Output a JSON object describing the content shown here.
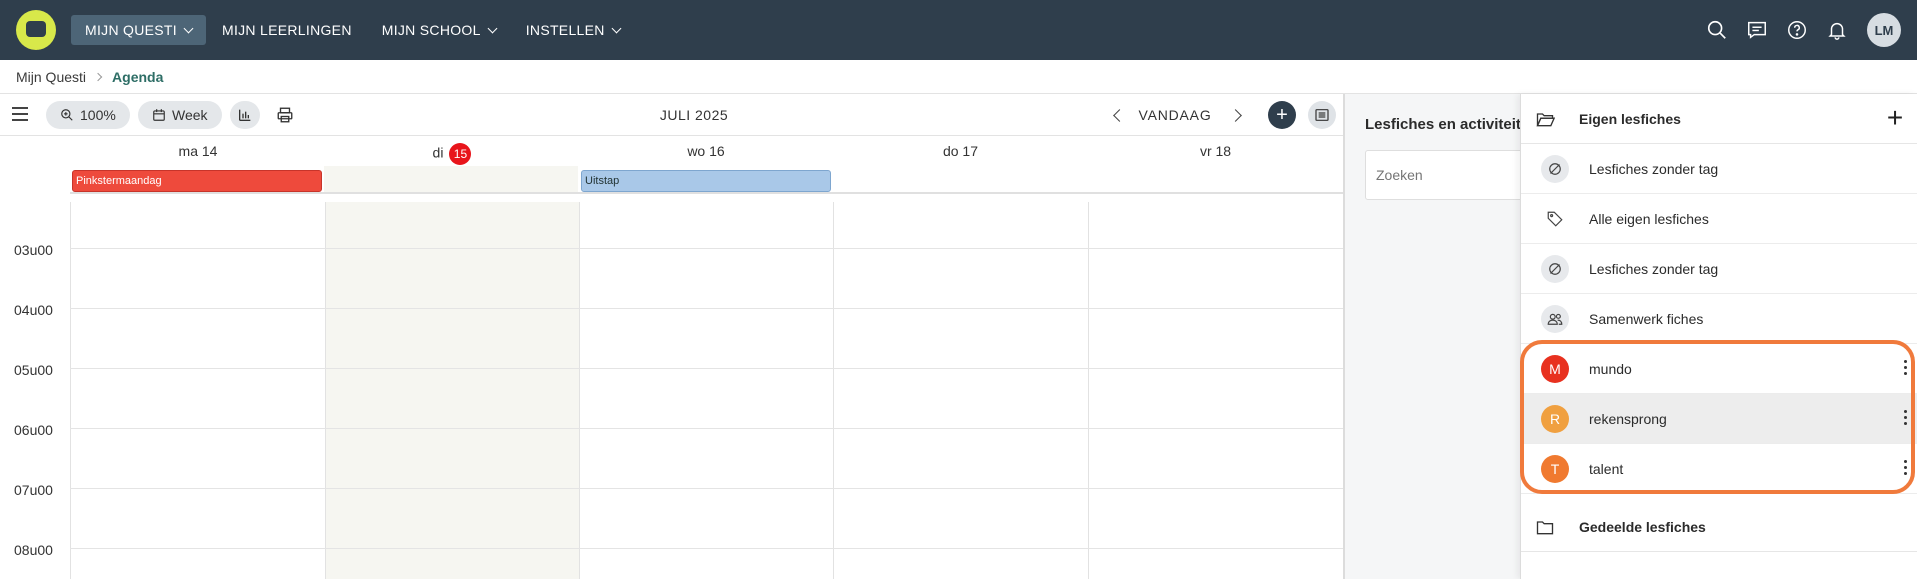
{
  "topnav": {
    "items": [
      {
        "label": "MIJN QUESTI",
        "active": true
      },
      {
        "label": "MIJN LEERLINGEN",
        "active": false
      },
      {
        "label": "MIJN SCHOOL",
        "active": false
      },
      {
        "label": "INSTELLEN",
        "active": false
      }
    ],
    "icons": [
      "search-icon",
      "chat-icon",
      "help-icon",
      "bell-icon"
    ],
    "avatar_initials": "LM"
  },
  "breadcrumb": {
    "home": "Mijn Questi",
    "current": "Agenda"
  },
  "toolbar": {
    "zoom_label": "100%",
    "view_label": "Week",
    "month_label": "JULI 2025",
    "today_label": "VANDAAG",
    "add_label": "+"
  },
  "days": [
    {
      "label": "ma 14"
    },
    {
      "label": "di",
      "badge": "15"
    },
    {
      "label": "wo 16"
    },
    {
      "label": "do 17"
    },
    {
      "label": "vr 18"
    }
  ],
  "events": [
    {
      "label": "Pinkstermaandag",
      "day": 0,
      "kind": "holiday"
    },
    {
      "label": "Uitstap",
      "day": 2,
      "kind": "trip"
    }
  ],
  "hours": [
    "03u00",
    "04u00",
    "05u00",
    "06u00",
    "07u00",
    "08u00"
  ],
  "midpanel": {
    "title": "Lesfiches en activiteit",
    "search_placeholder": "Zoeken"
  },
  "drawer": {
    "own_title": "Eigen lesfiches",
    "shared_title": "Gedeelde lesfiches",
    "items": [
      {
        "label": "Lesfiches zonder tag",
        "icon": "no-tag-icon"
      },
      {
        "label": "Alle eigen lesfiches",
        "icon": "tag-icon"
      },
      {
        "label": "Lesfiches zonder tag",
        "icon": "no-tag-icon"
      },
      {
        "label": "Samenwerk fiches",
        "icon": "users-icon"
      }
    ],
    "tags": [
      {
        "letter": "M",
        "label": "mundo",
        "color": "#e8311f"
      },
      {
        "letter": "R",
        "label": "rekensprong",
        "color": "#f0a040"
      },
      {
        "letter": "T",
        "label": "talent",
        "color": "#f07a30"
      }
    ]
  },
  "colors": {
    "topbar": "#2f3e4c",
    "logo": "#d8e84a",
    "accent_breadcrumb": "#2e6e66",
    "today_badge": "#e8151b",
    "highlight": "#f07a3c"
  }
}
